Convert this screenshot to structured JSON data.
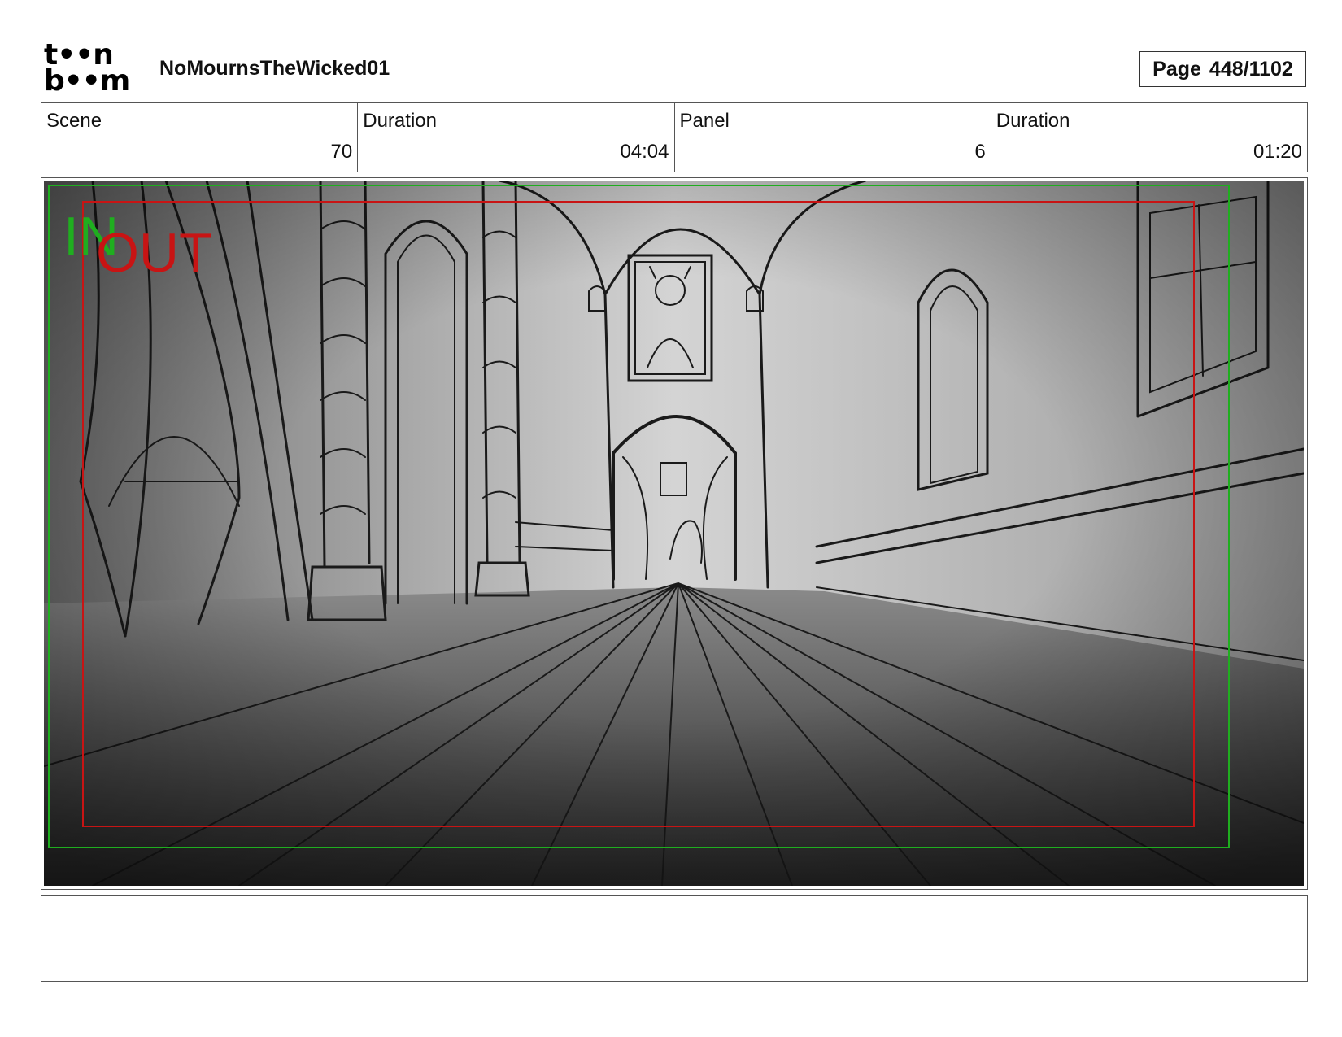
{
  "header": {
    "logo_line1": "t••n",
    "logo_line2": "b••m",
    "project_title": "NoMournsTheWicked01",
    "page_label": "Page",
    "page_value": "448/1102"
  },
  "info": {
    "scene_label": "Scene",
    "scene_value": "70",
    "scene_duration_label": "Duration",
    "scene_duration_value": "04:04",
    "panel_label": "Panel",
    "panel_value": "6",
    "panel_duration_label": "Duration",
    "panel_duration_value": "01:20"
  },
  "panel": {
    "in_label": "IN",
    "out_label": "OUT",
    "in_color": "#1fae1f",
    "out_color": "#c81414"
  },
  "notes": {
    "text": ""
  }
}
